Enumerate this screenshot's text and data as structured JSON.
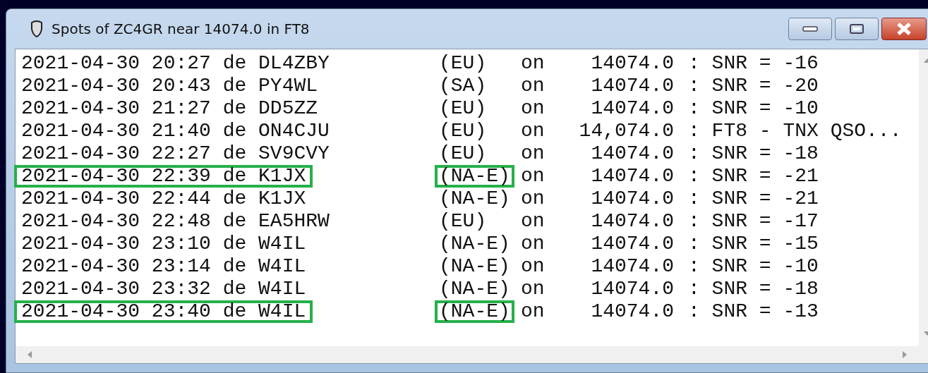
{
  "window": {
    "title": "Spots of ZC4GR near 14074.0 in FT8"
  },
  "spots": [
    {
      "spot": "2021-04-30 20:27 de DL4ZBY",
      "region": "(EU)",
      "on": "on",
      "freq": "14074.0",
      "info": ": SNR = -16",
      "highlighted": false
    },
    {
      "spot": "2021-04-30 20:43 de PY4WL",
      "region": "(SA)",
      "on": "on",
      "freq": "14074.0",
      "info": ": SNR = -20",
      "highlighted": false
    },
    {
      "spot": "2021-04-30 21:27 de DD5ZZ",
      "region": "(EU)",
      "on": "on",
      "freq": "14074.0",
      "info": ": SNR = -10",
      "highlighted": false
    },
    {
      "spot": "2021-04-30 21:40 de ON4CJU",
      "region": "(EU)",
      "on": "on",
      "freq": "14,074.0",
      "info": ": FT8 - TNX QSO...",
      "highlighted": false
    },
    {
      "spot": "2021-04-30 22:27 de SV9CVY",
      "region": "(EU)",
      "on": "on",
      "freq": "14074.0",
      "info": ": SNR = -18",
      "highlighted": false
    },
    {
      "spot": "2021-04-30 22:39 de K1JX",
      "region": "(NA-E)",
      "on": "on",
      "freq": "14074.0",
      "info": ": SNR = -21",
      "highlighted": true
    },
    {
      "spot": "2021-04-30 22:44 de K1JX",
      "region": "(NA-E)",
      "on": "on",
      "freq": "14074.0",
      "info": ": SNR = -21",
      "highlighted": false
    },
    {
      "spot": "2021-04-30 22:48 de EA5HRW",
      "region": "(EU)",
      "on": "on",
      "freq": "14074.0",
      "info": ": SNR = -17",
      "highlighted": false
    },
    {
      "spot": "2021-04-30 23:10 de W4IL",
      "region": "(NA-E)",
      "on": "on",
      "freq": "14074.0",
      "info": ": SNR = -15",
      "highlighted": false
    },
    {
      "spot": "2021-04-30 23:14 de W4IL",
      "region": "(NA-E)",
      "on": "on",
      "freq": "14074.0",
      "info": ": SNR = -10",
      "highlighted": false
    },
    {
      "spot": "2021-04-30 23:32 de W4IL",
      "region": "(NA-E)",
      "on": "on",
      "freq": "14074.0",
      "info": ": SNR = -18",
      "highlighted": false
    },
    {
      "spot": "2021-04-30 23:40 de W4IL",
      "region": "(NA-E)",
      "on": "on",
      "freq": "14074.0",
      "info": ": SNR = -13",
      "highlighted": true
    }
  ]
}
